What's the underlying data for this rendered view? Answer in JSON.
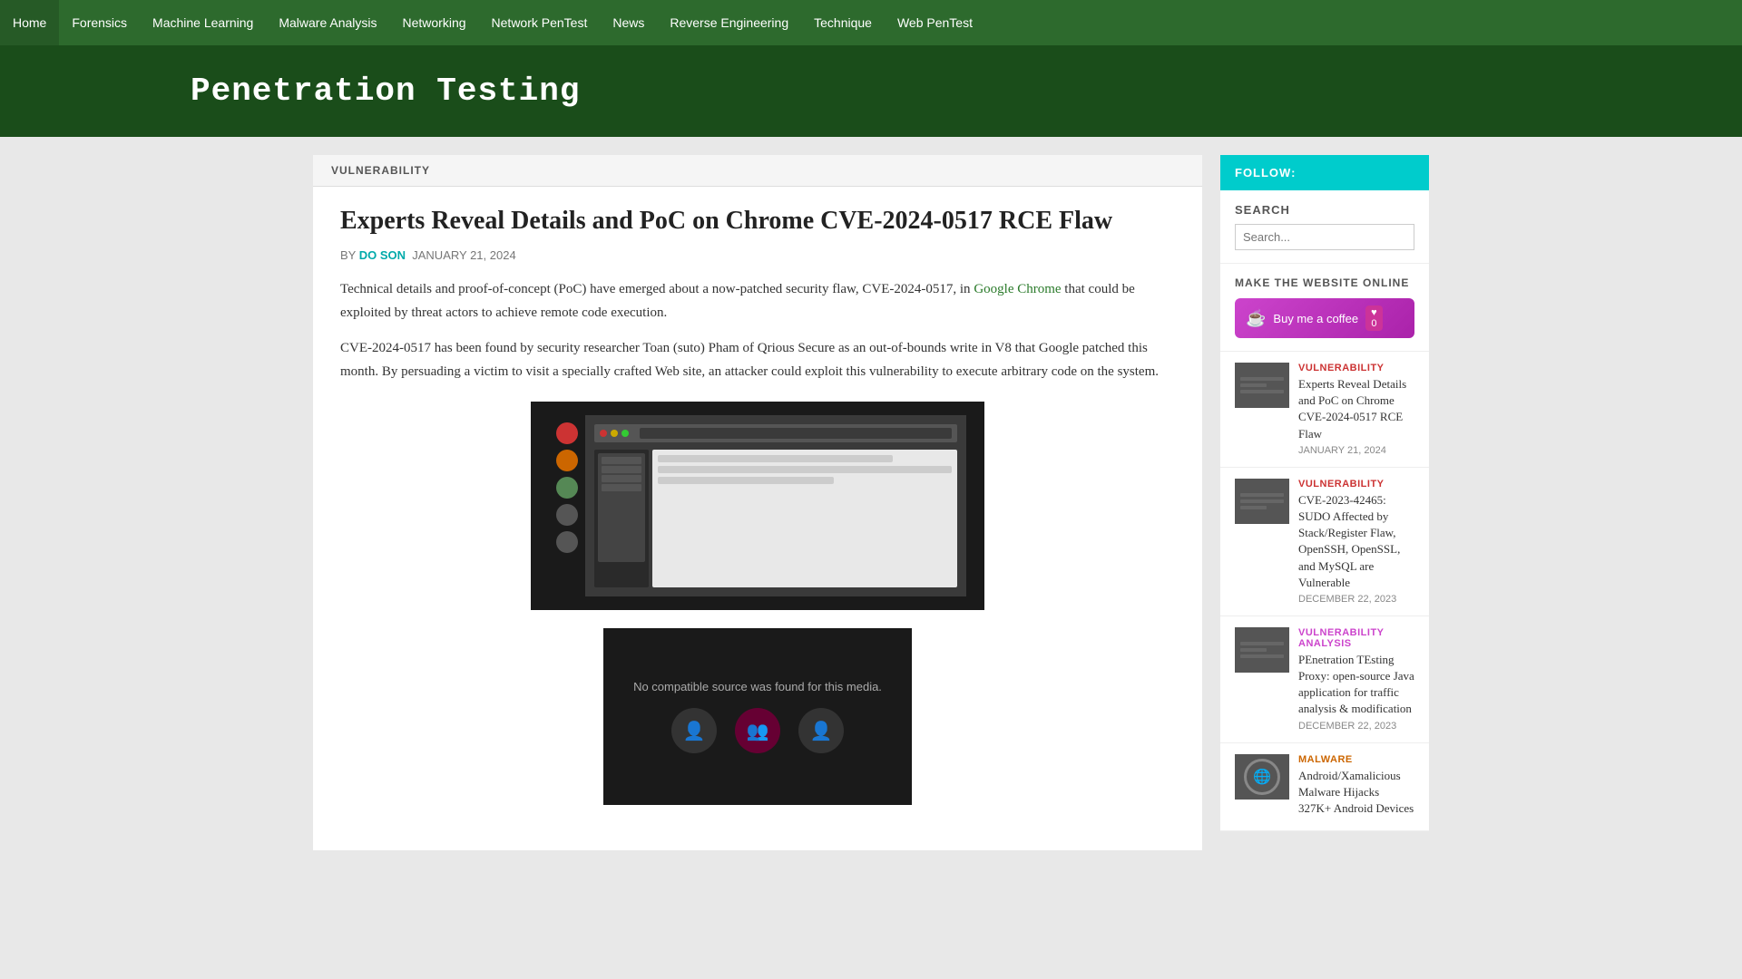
{
  "nav": {
    "items": [
      {
        "label": "Home",
        "href": "#"
      },
      {
        "label": "Forensics",
        "href": "#"
      },
      {
        "label": "Machine Learning",
        "href": "#"
      },
      {
        "label": "Malware Analysis",
        "href": "#"
      },
      {
        "label": "Networking",
        "href": "#"
      },
      {
        "label": "Network PenTest",
        "href": "#"
      },
      {
        "label": "News",
        "href": "#"
      },
      {
        "label": "Reverse Engineering",
        "href": "#"
      },
      {
        "label": "Technique",
        "href": "#"
      },
      {
        "label": "Web PenTest",
        "href": "#"
      }
    ]
  },
  "site": {
    "title": "Penetration Testing"
  },
  "article": {
    "category": "VULNERABILITY",
    "title": "Experts Reveal Details and PoC on Chrome CVE-2024-0517 RCE Flaw",
    "author": "DO SON",
    "date": "JANUARY 21, 2024",
    "body_1": "Technical details and proof-of-concept (PoC) have emerged about a now-patched security flaw, CVE-2024-0517, in",
    "body_link": "Google Chrome",
    "body_1_end": " that could be exploited by threat actors to achieve remote code execution.",
    "body_2": "CVE-2024-0517 has been found by security researcher Toan (suto) Pham of Qrious Secure as an out-of-bounds write in V8 that Google patched this month. By persuading a victim to visit a specially crafted Web site, an attacker could exploit this vulnerability to execute arbitrary code on the system.",
    "video_text": "No compatible source was found for this media."
  },
  "sidebar": {
    "follow_label": "FOLLOW:",
    "search_label": "SEARCH",
    "make_online_label": "MAKE THE WEBSITE ONLINE",
    "coffee_btn_label": "Buy me a coffee",
    "heart_label": "♥",
    "heart_count": "0",
    "recent_posts": [
      {
        "category": "VULNERABILITY",
        "cat_class": "cat-vulnerability",
        "title": "Experts Reveal Details and PoC on Chrome CVE-2024-0517 RCE Flaw",
        "date": "JANUARY 21, 2024"
      },
      {
        "category": "VULNERABILITY",
        "cat_class": "cat-vulnerability",
        "title": "CVE-2023-42465: SUDO Affected by Stack/Register Flaw, OpenSSH, OpenSSL, and MySQL are Vulnerable",
        "date": "DECEMBER 22, 2023"
      },
      {
        "category": "VULNERABILITY ANALYSIS",
        "cat_class": "cat-vuln-analysis",
        "title": "PEnetration TEsting Proxy: open-source Java application for traffic analysis & modification",
        "date": "DECEMBER 22, 2023"
      },
      {
        "category": "MALWARE",
        "cat_class": "cat-malware",
        "title": "Android/Xamalicious Malware Hijacks 327K+ Android Devices",
        "date": ""
      }
    ]
  }
}
